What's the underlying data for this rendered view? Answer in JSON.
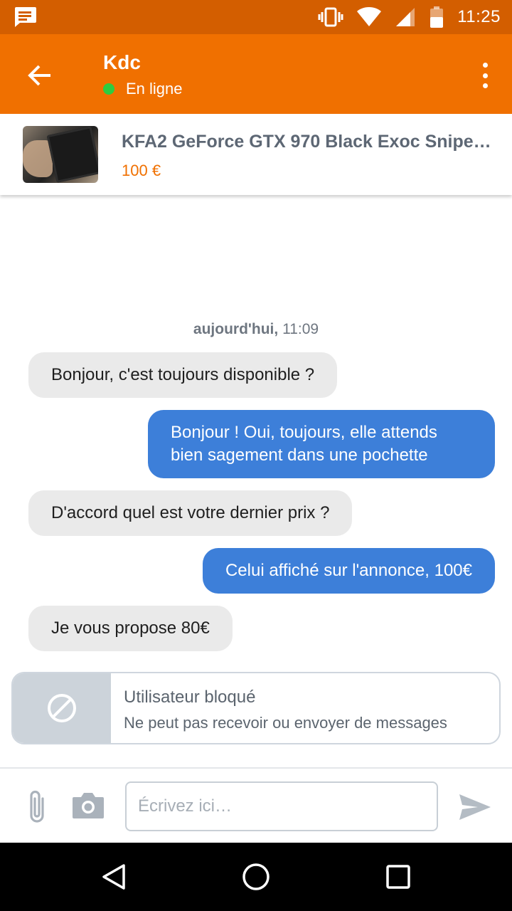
{
  "status_bar": {
    "time": "11:25"
  },
  "header": {
    "contact_name": "Kdc",
    "status": "En ligne",
    "status_color": "#2ecc40"
  },
  "listing": {
    "title": "KFA2 GeForce GTX 970 Black Exoc Sniper…",
    "price": "100 €"
  },
  "conversation": {
    "date_label": "aujourd'hui,",
    "date_time": "11:09",
    "messages": [
      {
        "direction": "in",
        "text": "Bonjour, c'est toujours disponible ?"
      },
      {
        "direction": "out",
        "text": "Bonjour ! Oui, toujours, elle attends bien sagement dans une pochette"
      },
      {
        "direction": "in",
        "text": "D'accord quel est votre dernier prix ?"
      },
      {
        "direction": "out",
        "text": "Celui affiché sur l'annonce, 100€"
      },
      {
        "direction": "in",
        "text": "Je vous propose 80€"
      }
    ]
  },
  "blocked_notice": {
    "title": "Utilisateur bloqué",
    "subtitle": "Ne peut pas recevoir ou envoyer de messages"
  },
  "composer": {
    "placeholder": "Écrivez ici…"
  },
  "colors": {
    "status_bar": "#d35e00",
    "app_bar": "#f07000",
    "bubble_out": "#3d7fd9",
    "bubble_in": "#eaeaea",
    "price": "#f07000"
  },
  "icons": [
    "message-notification-icon",
    "vibrate-icon",
    "wifi-icon",
    "signal-icon",
    "battery-icon",
    "back-arrow-icon",
    "more-vert-icon",
    "block-icon",
    "paperclip-icon",
    "camera-icon",
    "send-icon",
    "nav-back-icon",
    "nav-home-icon",
    "nav-recents-icon"
  ]
}
